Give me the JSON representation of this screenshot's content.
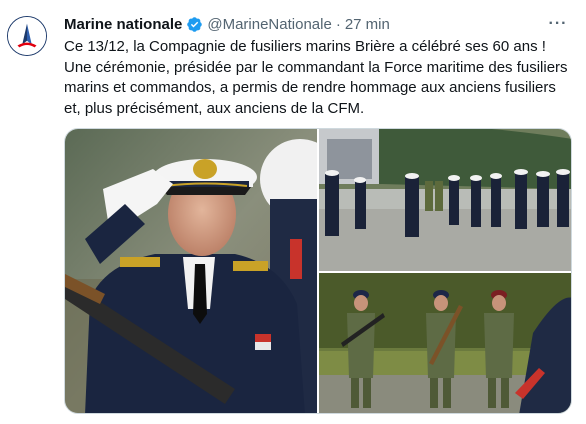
{
  "tweet": {
    "author_name": "Marine nationale",
    "author_handle": "@MarineNationale",
    "separator": "·",
    "time": "27 min",
    "more_icon": "more-horizontal-icon",
    "verified_icon": "verified-badge-icon",
    "text_lines": [
      "Ce 13/12, la Compagnie de fusiliers marins Brière a célébré ses 60 ans !",
      "Une cérémonie, présidée par le commandant la Force maritime des fusiliers marins et commandos, a permis de rendre hommage aux anciens fusiliers et, plus précisément, aux anciens de la CFM."
    ]
  },
  "colors": {
    "verified": "#1d9bf0",
    "secondary_text": "#536471",
    "navy": "#1d3a6b",
    "accent_red": "#e1000f"
  }
}
